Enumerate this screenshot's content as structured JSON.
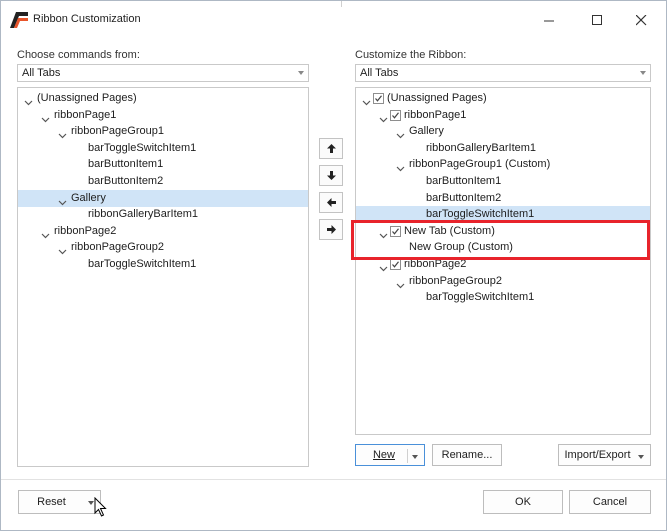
{
  "window": {
    "title": "Ribbon Customization"
  },
  "left": {
    "label": "Choose commands from:",
    "combo_value": "All Tabs",
    "tree": [
      {
        "text": "(Unassigned Pages)",
        "level": 0,
        "expand": true
      },
      {
        "text": "ribbonPage1",
        "level": 1,
        "expand": true
      },
      {
        "text": "ribbonPageGroup1",
        "level": 2,
        "expand": true
      },
      {
        "text": "barToggleSwitchItem1",
        "level": 3,
        "expand": false
      },
      {
        "text": "barButtonItem1",
        "level": 3,
        "expand": false
      },
      {
        "text": "barButtonItem2",
        "level": 3,
        "expand": false
      },
      {
        "text": "Gallery",
        "level": 2,
        "expand": true,
        "selected": true
      },
      {
        "text": "ribbonGalleryBarItem1",
        "level": 3,
        "expand": false
      },
      {
        "text": "ribbonPage2",
        "level": 1,
        "expand": true
      },
      {
        "text": "ribbonPageGroup2",
        "level": 2,
        "expand": true
      },
      {
        "text": "barToggleSwitchItem1",
        "level": 3,
        "expand": false
      }
    ]
  },
  "right": {
    "label": "Customize the Ribbon:",
    "combo_value": "All Tabs",
    "tree": [
      {
        "text": "(Unassigned Pages)",
        "level": 0,
        "expand": true,
        "check": true
      },
      {
        "text": "ribbonPage1",
        "level": 1,
        "expand": true,
        "check": true
      },
      {
        "text": "Gallery",
        "level": 2,
        "expand": true,
        "check": false
      },
      {
        "text": "ribbonGalleryBarItem1",
        "level": 3,
        "expand": false,
        "check": false
      },
      {
        "text": "ribbonPageGroup1 (Custom)",
        "level": 2,
        "expand": true,
        "check": false
      },
      {
        "text": "barButtonItem1",
        "level": 3,
        "expand": false,
        "check": false
      },
      {
        "text": "barButtonItem2",
        "level": 3,
        "expand": false,
        "check": false
      },
      {
        "text": "barToggleSwitchItem1",
        "level": 3,
        "expand": false,
        "check": false,
        "selected": true
      },
      {
        "text": "New Tab (Custom)",
        "level": 1,
        "expand": true,
        "check": true
      },
      {
        "text": "New Group (Custom)",
        "level": 2,
        "expand": false,
        "check": false
      },
      {
        "text": "ribbonPage2",
        "level": 1,
        "expand": true,
        "check": true
      },
      {
        "text": "ribbonPageGroup2",
        "level": 2,
        "expand": true,
        "check": false
      },
      {
        "text": "barToggleSwitchItem1",
        "level": 3,
        "expand": false,
        "check": false
      }
    ]
  },
  "buttons": {
    "new": "New",
    "rename": "Rename...",
    "import_export": "Import/Export",
    "reset": "Reset",
    "ok": "OK",
    "cancel": "Cancel"
  },
  "colors": {
    "highlight": "#e8232b",
    "selection": "#d0e4f7",
    "focus": "#4a90d9"
  }
}
